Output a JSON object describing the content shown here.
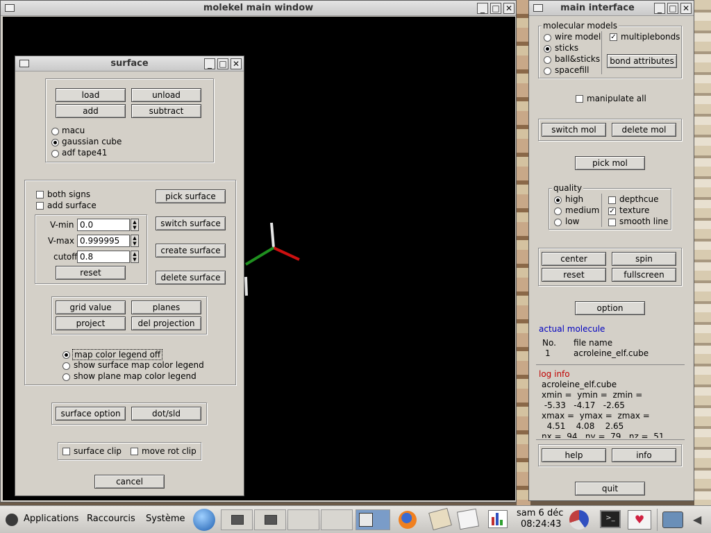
{
  "main_window": {
    "title": "molekel main window"
  },
  "surface": {
    "title": "surface",
    "load": "load",
    "unload": "unload",
    "add": "add",
    "subtract": "subtract",
    "formats": [
      "macu",
      "gaussian cube",
      "adf tape41"
    ],
    "both_signs": "both signs",
    "add_surface": "add surface",
    "vmin_label": "V-min",
    "vmin": "0.0",
    "vmax_label": "V-max",
    "vmax": "0.999995",
    "cutoff_label": "cutoff",
    "cutoff": "0.8",
    "reset": "reset",
    "pick_surface": "pick surface",
    "switch_surface": "switch surface",
    "create_surface": "create surface",
    "delete_surface": "delete surface",
    "grid_value": "grid value",
    "planes": "planes",
    "project": "project",
    "del_projection": "del projection",
    "legend_opts": [
      "map color legend off",
      "show surface map color legend",
      "show plane map color legend"
    ],
    "surface_option": "surface option",
    "dot_sld": "dot/sld",
    "surface_clip": "surface clip",
    "move_rot_clip": "move rot clip",
    "cancel": "cancel"
  },
  "main_interface": {
    "title": "main interface",
    "molecular_models": "molecular models",
    "models": [
      "wire model",
      "sticks",
      "ball&sticks",
      "spacefill"
    ],
    "multiplebonds": "multiplebonds",
    "bond_attributes": "bond attributes",
    "manipulate_all": "manipulate all",
    "switch_mol": "switch mol",
    "delete_mol": "delete mol",
    "pick_mol": "pick mol",
    "quality": "quality",
    "quality_opts": [
      "high",
      "medium",
      "low"
    ],
    "depthcue": "depthcue",
    "texture": "texture",
    "smooth_line": "smooth line",
    "center": "center",
    "spin": "spin",
    "reset": "reset",
    "fullscreen": "fullscreen",
    "option": "option",
    "actual_molecule": "actual molecule",
    "col_no": "No.",
    "col_file": "file name",
    "mol_no": "1",
    "mol_file": "acroleine_elf.cube",
    "log_info": "log info",
    "log_lines": [
      "acroleine_elf.cube",
      "xmin =  ymin =  zmin =",
      " -5.33   -4.17   -2.65",
      "xmax =  ymax =  zmax =",
      "  4.51    4.08    2.65",
      "nx =  94   ny =  79   nz =  51"
    ],
    "help": "help",
    "info": "info",
    "quit": "quit"
  },
  "taskbar": {
    "applications": "Applications",
    "raccourcis": "Raccourcis",
    "systeme": "Système",
    "date": "sam  6 déc",
    "time": "08:24:43"
  },
  "colors": {
    "desktop_bg": "#6b5a48",
    "window_bg": "#d4d0c8",
    "canvas": "#000000",
    "blue_label": "#0000c0",
    "red_label": "#c00000"
  }
}
